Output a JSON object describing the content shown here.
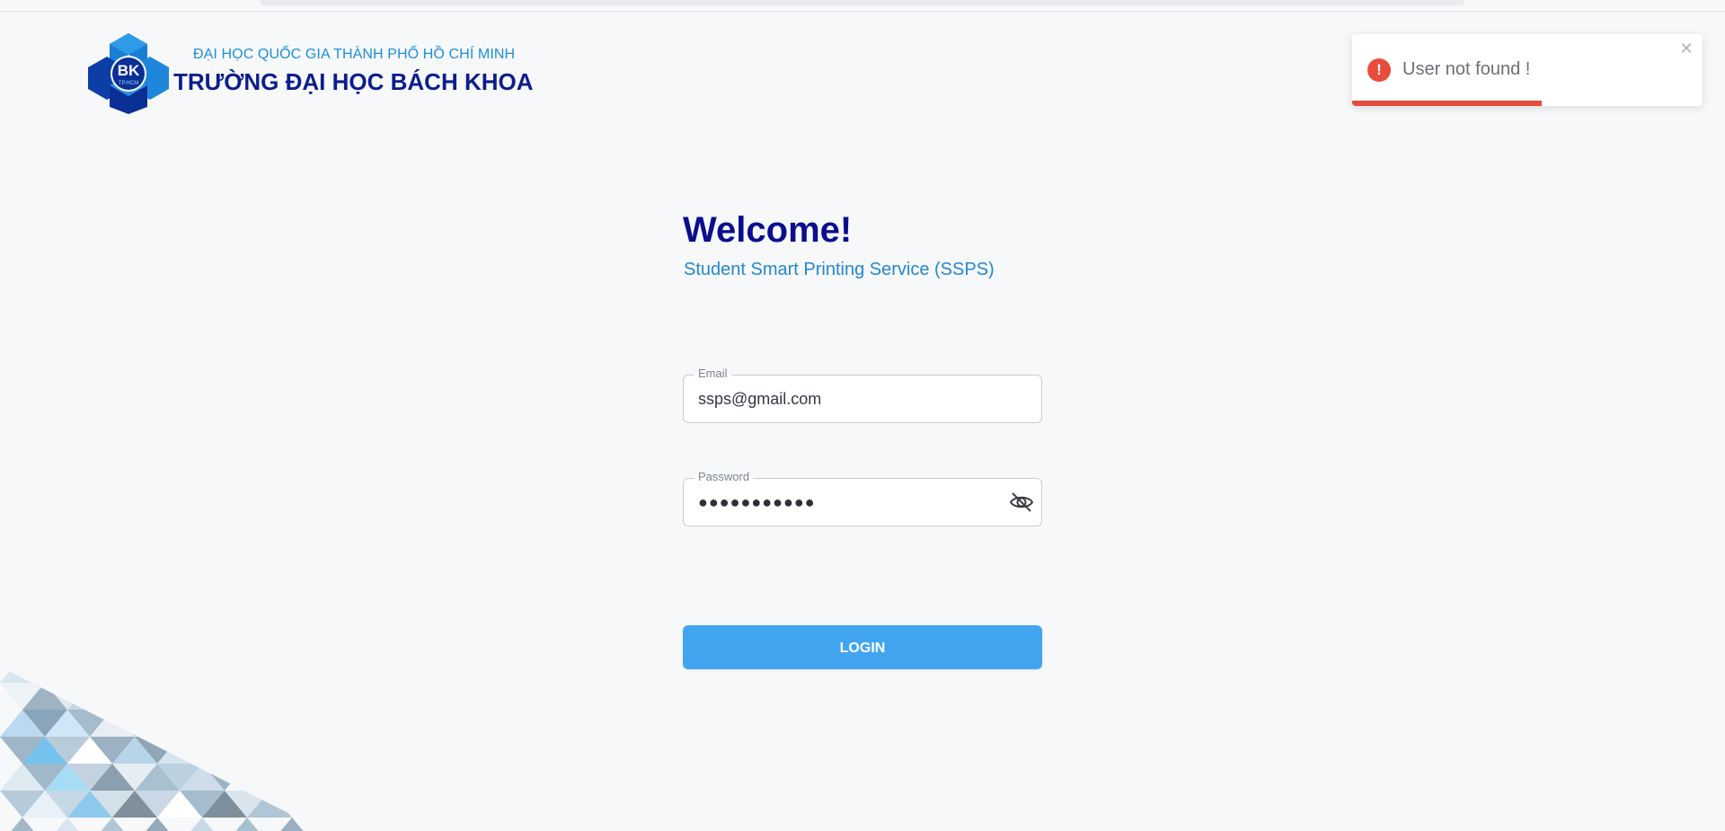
{
  "header": {
    "university_sub": "ĐẠI HỌC QUỐC GIA THÀNH PHỐ HỒ CHÍ MINH",
    "university_title": "TRƯỜNG ĐẠI HỌC BÁCH KHOA",
    "logo_text_main": "BK",
    "logo_text_sub": "TP.HCM",
    "logo_icon": "bk-logo-icon"
  },
  "main": {
    "welcome": "Welcome!",
    "subtitle": "Student Smart Printing Service (SSPS)"
  },
  "form": {
    "email_label": "Email",
    "email_value": "ssps@gmail.com",
    "password_label": "Password",
    "password_masked": "●●●●●●●●●●●",
    "password_toggle_icon": "eye-slash-icon",
    "login_label": "LOGIN"
  },
  "toast": {
    "message": "User not found !",
    "icon": "error-icon",
    "close_icon": "close-icon",
    "close_glyph": "✕",
    "progress_fraction": 0.54
  },
  "colors": {
    "brand_navy": "#0b0e8c",
    "brand_blue": "#1f8fd6",
    "button": "#42a5f0",
    "error": "#e74c3c",
    "background": "#f6f8fa"
  }
}
